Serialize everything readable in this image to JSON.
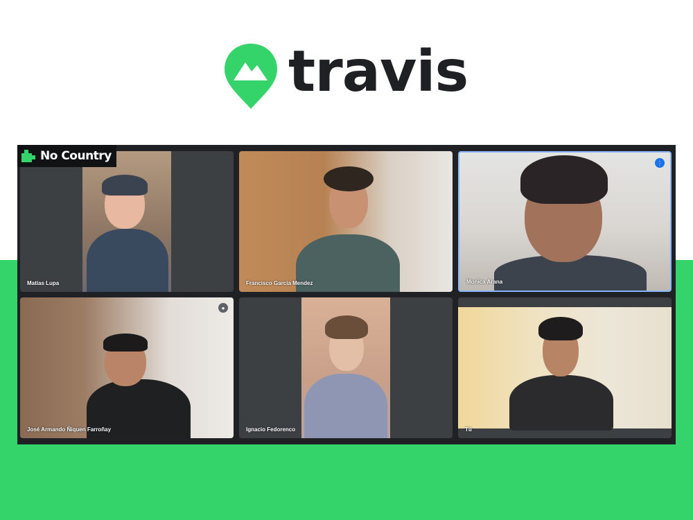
{
  "brand": {
    "name": "travis",
    "logo_icon": "map-pin-mountain-icon",
    "accent_color": "#35d46a",
    "text_color": "#1f2023"
  },
  "meeting": {
    "watermark": "No Country",
    "participants": [
      {
        "name": "Matías Lupa",
        "status": ""
      },
      {
        "name": "Francisco García Mendez",
        "status": ""
      },
      {
        "name": "Monica Arana",
        "status": "speaking"
      },
      {
        "name": "José Armando Ñiquen Farroñay",
        "status": "muted"
      },
      {
        "name": "Ignacio Fedorenco",
        "status": ""
      },
      {
        "name": "Tú",
        "status": ""
      }
    ]
  }
}
